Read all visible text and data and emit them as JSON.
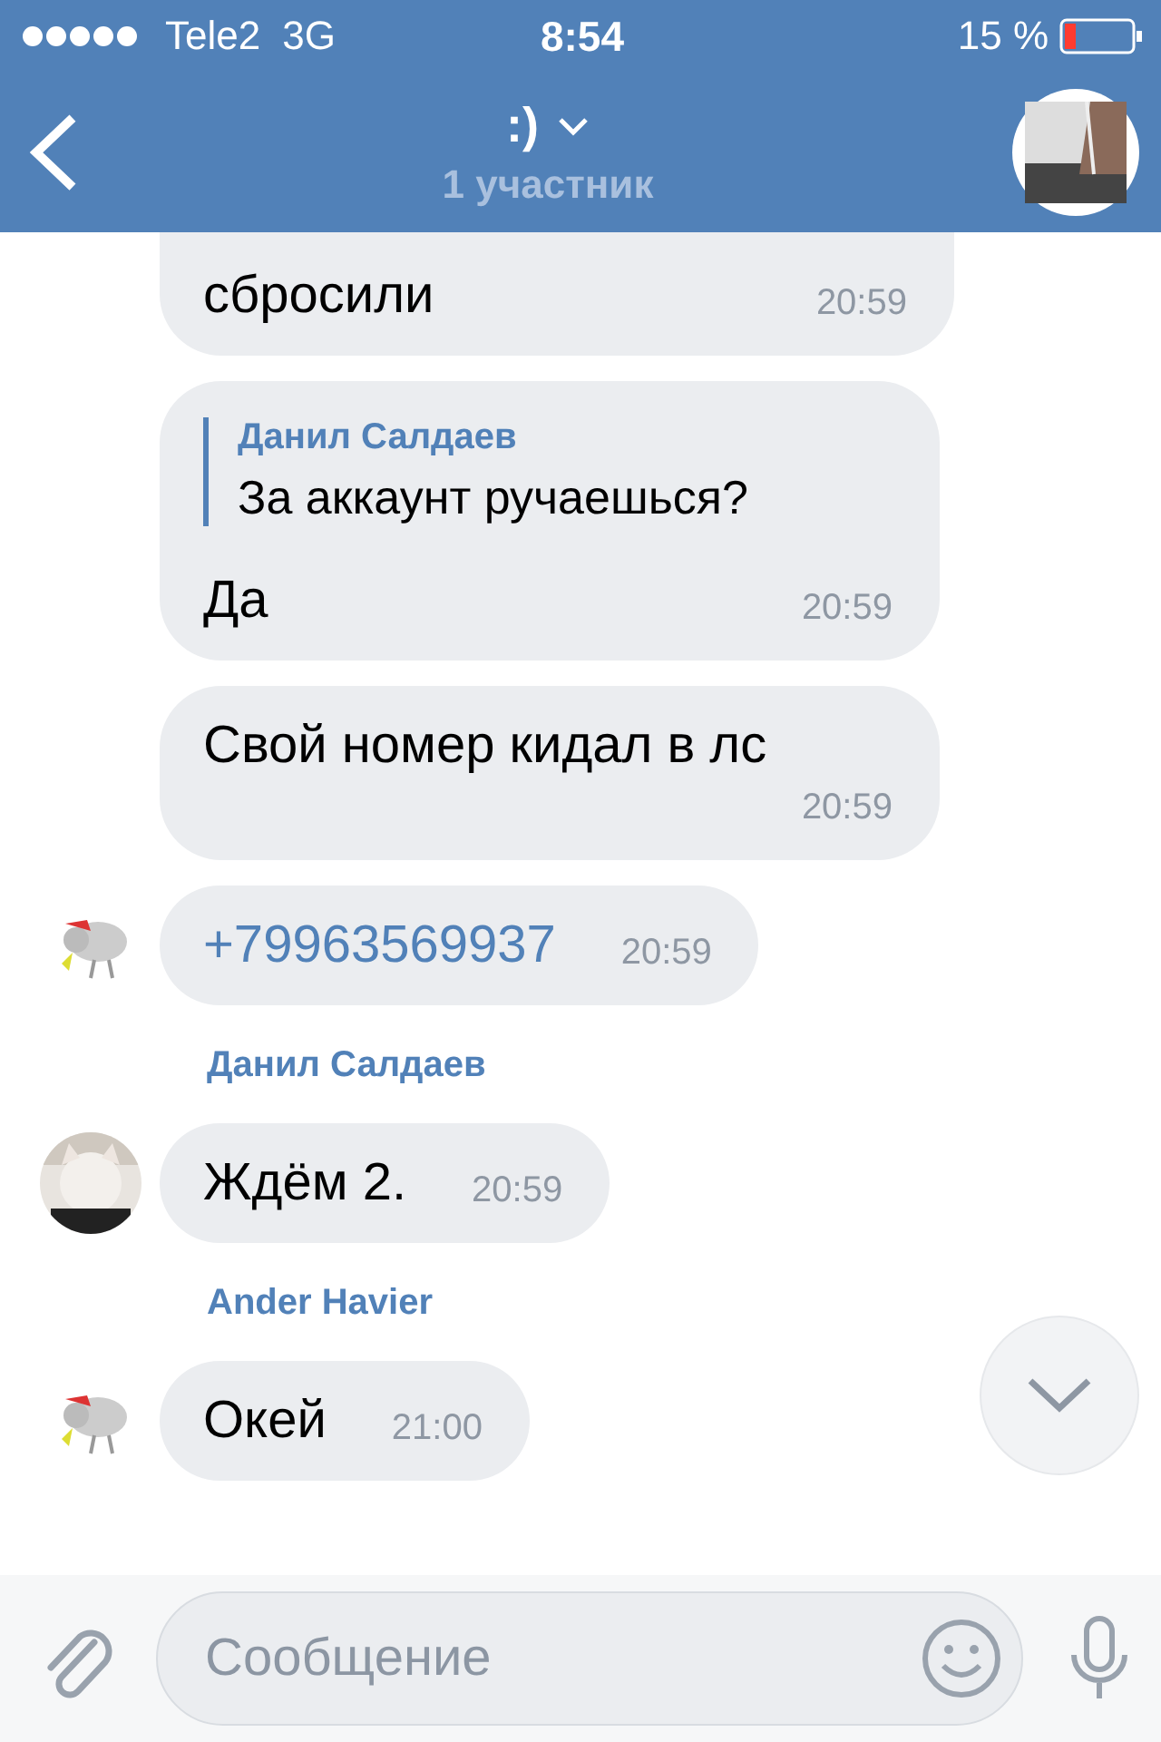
{
  "status_bar": {
    "carrier": "Tele2",
    "network": "3G",
    "time": "8:54",
    "battery": "15 %"
  },
  "header": {
    "title": ":)",
    "subtitle": "1 участник"
  },
  "messages": [
    {
      "kind": "text",
      "text": "сбросили",
      "time": "20:59",
      "cut_top": true
    },
    {
      "kind": "text",
      "quote": {
        "author": "Данил Салдаев",
        "text": "За аккаунт ручаешься?"
      },
      "text": "Да",
      "time": "20:59"
    },
    {
      "kind": "text",
      "text": "Свой номер кидал в лс",
      "time": "20:59"
    },
    {
      "kind": "link",
      "text": "+79963569937",
      "time": "20:59",
      "avatar": {
        "kind": "sketch"
      }
    },
    {
      "kind": "text",
      "sender": "Данил Салдаев",
      "text": "Ждём 2.",
      "time": "20:59"
    },
    {
      "kind": "text",
      "sender": "Ander Havier",
      "text": "Окей",
      "time": "21:00",
      "avatar": {
        "kind": "sketch"
      }
    }
  ],
  "composer": {
    "placeholder": "Сообщение"
  }
}
